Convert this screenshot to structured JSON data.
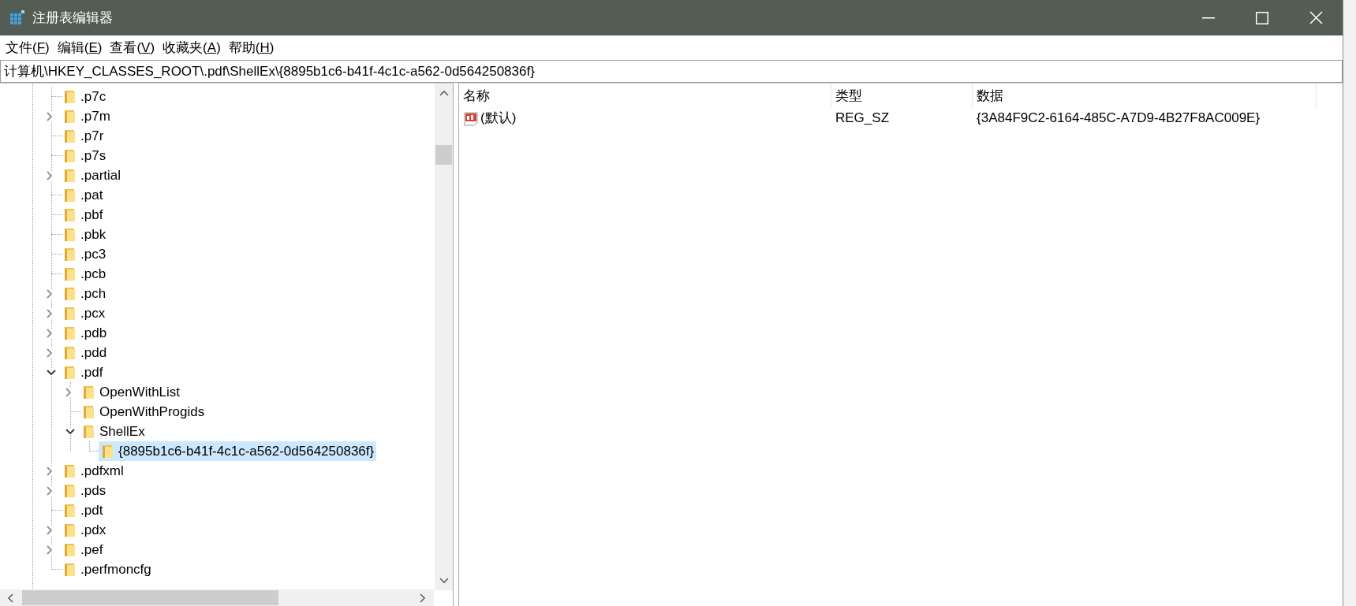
{
  "window": {
    "title": "注册表编辑器"
  },
  "menu": [
    {
      "label": "文件(",
      "key": "F",
      "end": ")"
    },
    {
      "label": "编辑(",
      "key": "E",
      "end": ")"
    },
    {
      "label": "查看(",
      "key": "V",
      "end": ")"
    },
    {
      "label": "收藏夹(",
      "key": "A",
      "end": ")"
    },
    {
      "label": "帮助(",
      "key": "H",
      "end": ")"
    }
  ],
  "address": "计算机\\HKEY_CLASSES_ROOT\\.pdf\\ShellEx\\{8895b1c6-b41f-4c1c-a562-0d564250836f}",
  "tree": [
    {
      "label": ".p7c",
      "kind": "leaf",
      "selected": false
    },
    {
      "label": ".p7m",
      "kind": "collapsed",
      "selected": false
    },
    {
      "label": ".p7r",
      "kind": "leaf",
      "selected": false
    },
    {
      "label": ".p7s",
      "kind": "leaf",
      "selected": false
    },
    {
      "label": ".partial",
      "kind": "collapsed",
      "selected": false
    },
    {
      "label": ".pat",
      "kind": "leaf",
      "selected": false
    },
    {
      "label": ".pbf",
      "kind": "leaf",
      "selected": false
    },
    {
      "label": ".pbk",
      "kind": "leaf",
      "selected": false
    },
    {
      "label": ".pc3",
      "kind": "leaf",
      "selected": false
    },
    {
      "label": ".pcb",
      "kind": "leaf",
      "selected": false
    },
    {
      "label": ".pch",
      "kind": "collapsed",
      "selected": false
    },
    {
      "label": ".pcx",
      "kind": "collapsed",
      "selected": false
    },
    {
      "label": ".pdb",
      "kind": "collapsed",
      "selected": false
    },
    {
      "label": ".pdd",
      "kind": "collapsed",
      "selected": false
    },
    {
      "label": ".pdf",
      "kind": "expanded",
      "selected": false,
      "children": [
        {
          "label": "OpenWithList",
          "kind": "collapsed",
          "selected": false
        },
        {
          "label": "OpenWithProgids",
          "kind": "leaf",
          "selected": false
        },
        {
          "label": "ShellEx",
          "kind": "expanded",
          "selected": false,
          "children": [
            {
              "label": "{8895b1c6-b41f-4c1c-a562-0d564250836f}",
              "kind": "leaf",
              "selected": true
            }
          ]
        }
      ]
    },
    {
      "label": ".pdfxml",
      "kind": "collapsed",
      "selected": false
    },
    {
      "label": ".pds",
      "kind": "collapsed",
      "selected": false
    },
    {
      "label": ".pdt",
      "kind": "leaf",
      "selected": false
    },
    {
      "label": ".pdx",
      "kind": "collapsed",
      "selected": false
    },
    {
      "label": ".pef",
      "kind": "collapsed",
      "selected": false
    },
    {
      "label": ".perfmoncfg",
      "kind": "leaf",
      "selected": false
    }
  ],
  "values": {
    "columns": [
      "名称",
      "类型",
      "数据"
    ],
    "rows": [
      {
        "name": "(默认)",
        "type": "REG_SZ",
        "data": "{3A84F9C2-6164-485C-A7D9-4B27F8AC009E}"
      }
    ]
  }
}
